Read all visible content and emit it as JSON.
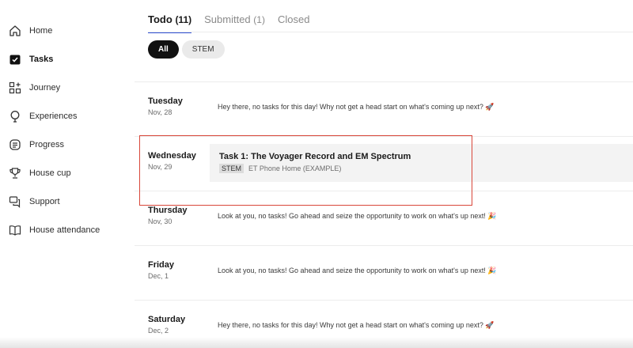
{
  "sidebar": {
    "items": [
      {
        "label": "Home",
        "icon": "home-icon"
      },
      {
        "label": "Tasks",
        "icon": "tasks-icon",
        "active": true
      },
      {
        "label": "Journey",
        "icon": "journey-icon"
      },
      {
        "label": "Experiences",
        "icon": "experiences-icon"
      },
      {
        "label": "Progress",
        "icon": "progress-icon"
      },
      {
        "label": "House cup",
        "icon": "trophy-icon"
      },
      {
        "label": "Support",
        "icon": "support-icon"
      },
      {
        "label": "House attendance",
        "icon": "book-icon"
      }
    ]
  },
  "tabs": [
    {
      "label": "Todo",
      "count": "(11)",
      "active": true
    },
    {
      "label": "Submitted",
      "count": "(1)"
    },
    {
      "label": "Closed",
      "count": ""
    }
  ],
  "filters": [
    {
      "label": "All",
      "active": true
    },
    {
      "label": "STEM"
    }
  ],
  "days": [
    {
      "name": "Tuesday",
      "date": "Nov, 28",
      "message": "Hey there, no tasks for this day! Why not get a head start on what's coming up next? 🚀"
    },
    {
      "name": "Wednesday",
      "date": "Nov, 29",
      "task": {
        "title": "Task 1: The Voyager Record and EM Spectrum",
        "tag": "STEM",
        "project": "ET Phone Home (EXAMPLE)"
      }
    },
    {
      "name": "Thursday",
      "date": "Nov, 30",
      "message": "Look at you, no tasks! Go ahead and seize the opportunity to work on what's up next! 🎉"
    },
    {
      "name": "Friday",
      "date": "Dec, 1",
      "message": "Look at you, no tasks! Go ahead and seize the opportunity to work on what's up next! 🎉"
    },
    {
      "name": "Saturday",
      "date": "Dec, 2",
      "message": "Hey there, no tasks for this day! Why not get a head start on what's coming up next? 🚀"
    }
  ],
  "colors": {
    "accent": "#2f4fd4",
    "highlight": "#d9473a",
    "chip_active": "#111111"
  }
}
